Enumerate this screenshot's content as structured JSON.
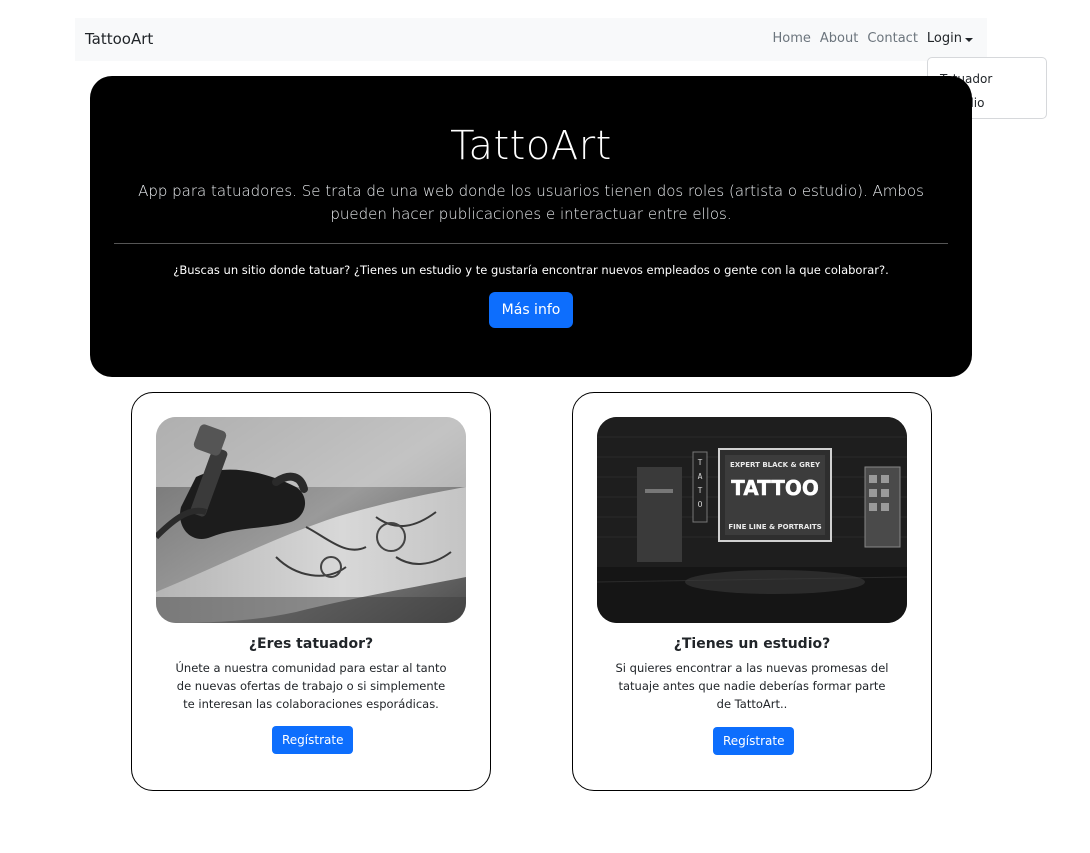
{
  "navbar": {
    "brand": "TattooArt",
    "links": [
      "Home",
      "About",
      "Contact"
    ],
    "login_label": "Login",
    "dropdown_items": [
      "Tatuador",
      "Estudio"
    ]
  },
  "hero": {
    "title": "TattoArt",
    "lead": "App para tatuadores. Se trata de una web donde los usuarios tienen dos roles (artista o estudio). Ambos pueden hacer publicaciones e interactuar entre ellos.",
    "subtext": "¿Buscas un sitio donde tatuar? ¿Tienes un estudio y te gustaría encontrar nuevos empleados o gente con la que colaborar?.",
    "button_label": "Más info"
  },
  "cards": [
    {
      "title": "¿Eres tatuador?",
      "text": "Únete a nuestra comunidad para estar al tanto de nuevas ofertas de trabajo o si simplemente te interesan las colaboraciones esporádicas.",
      "button_label": "Regístrate"
    },
    {
      "title": "¿Tienes un estudio?",
      "text": "Si quieres encontrar a las nuevas promesas del tatuaje antes que nadie deberías formar parte de TattoArt..",
      "button_label": "Regístrate"
    }
  ],
  "images": {
    "shop_sign_top": "EXPERT BLACK & GREY",
    "shop_sign_main": "TATTOO",
    "shop_sign_bottom": "FINE LINE & PORTRAITS",
    "shop_vertical_sign": "TATTOO"
  },
  "colors": {
    "primary": "#0d6efd",
    "hero_bg": "#000000",
    "navbar_bg": "#f8f9fa"
  }
}
